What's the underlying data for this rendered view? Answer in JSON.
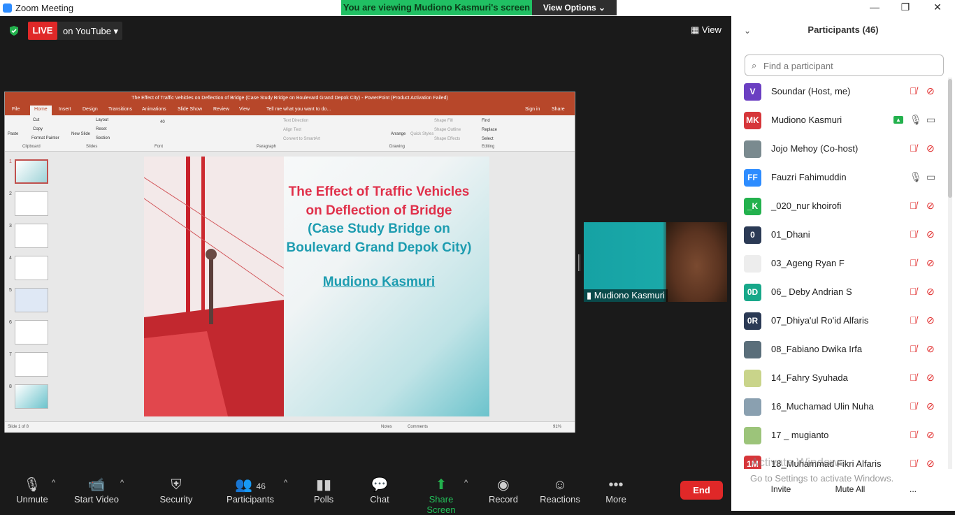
{
  "window": {
    "title": "Zoom Meeting",
    "minimize": "—",
    "restore": "❐",
    "close": "✕"
  },
  "banner": {
    "text": "You are viewing Mudiono Kasmuri's screen",
    "view_options": "View Options ⌄"
  },
  "live": {
    "badge": "LIVE",
    "destination": "on YouTube ▾"
  },
  "view_button": "▦ View",
  "ppt": {
    "title": "The Effect of Traffic Vehicles on Deflection of Bridge (Case Study Bridge on Boulevard Grand Depok City) - PowerPoint (Product Activation Failed)",
    "tabs": [
      "File",
      "Home",
      "Insert",
      "Design",
      "Transitions",
      "Animations",
      "Slide Show",
      "Review",
      "View",
      "Tell me what you want to do..."
    ],
    "sign_in": "Sign in",
    "share": "Share",
    "groups": [
      "Clipboard",
      "Slides",
      "Font",
      "Paragraph",
      "Drawing",
      "Editing"
    ],
    "ribbon_items": {
      "cut": "Cut",
      "copy": "Copy",
      "format_painter": "Format Painter",
      "paste": "Paste",
      "layout": "Layout",
      "reset": "Reset",
      "section": "Section",
      "new_slide": "New Slide",
      "font_size": "40",
      "text_direction": "Text Direction",
      "align_text": "Align Text",
      "convert": "Convert to SmartArt",
      "arrange": "Arrange",
      "quick_styles": "Quick Styles",
      "shape_fill": "Shape Fill",
      "shape_outline": "Shape Outline",
      "shape_effects": "Shape Effects",
      "find": "Find",
      "replace": "Replace",
      "select": "Select"
    },
    "slide_numbers": [
      "1",
      "2",
      "3",
      "4",
      "5",
      "6",
      "7",
      "8"
    ],
    "slide": {
      "title_red": [
        "The Effect of Traffic Vehicles",
        "on Deflection of Bridge"
      ],
      "title_teal": [
        "(Case Study Bridge on",
        "Boulevard Grand Depok City)"
      ],
      "author": "Mudiono Kasmuri"
    },
    "status": {
      "slide": "Slide 1 of 8",
      "notes": "Notes",
      "comments": "Comments",
      "zoom": "91%"
    }
  },
  "thumbnail_video": {
    "name": "Mudiono Kasmuri"
  },
  "toolbar": {
    "unmute": "Unmute",
    "start_video": "Start Video",
    "security": "Security",
    "participants": "Participants",
    "participants_count": "46",
    "polls": "Polls",
    "chat": "Chat",
    "share_screen": "Share Screen",
    "record": "Record",
    "reactions": "Reactions",
    "more": "More",
    "end": "End"
  },
  "panel": {
    "title": "Participants (46)",
    "search_placeholder": "Find a participant",
    "participants": [
      {
        "initials": "V",
        "color": "#6b3fc2",
        "name": "Soundar (Host, me)",
        "mic": "muted",
        "cam": "off"
      },
      {
        "initials": "MK",
        "color": "#d6363a",
        "name": "Mudiono Kasmuri",
        "mic": "on",
        "cam": "on",
        "sharing": true
      },
      {
        "initials": "",
        "color": "#7a8a8f",
        "name": "Jojo Mehoy (Co-host)",
        "mic": "muted",
        "cam": "off"
      },
      {
        "initials": "FF",
        "color": "#2d8cff",
        "name": "Fauzri Fahimuddin",
        "mic": "on",
        "cam": "on"
      },
      {
        "initials": "_K",
        "color": "#23b14d",
        "name": "_020_nur khoirofi",
        "mic": "muted",
        "cam": "off"
      },
      {
        "initials": "0",
        "color": "#2b3a55",
        "name": "01_Dhani",
        "mic": "muted",
        "cam": "off"
      },
      {
        "initials": "",
        "color": "#ededed",
        "name": "03_Ageng Ryan F",
        "mic": "muted",
        "cam": "off"
      },
      {
        "initials": "0D",
        "color": "#18a88a",
        "name": "06_ Deby Andrian S",
        "mic": "muted",
        "cam": "off"
      },
      {
        "initials": "0R",
        "color": "#2b3a55",
        "name": "07_Dhiya'ul Ro'id Alfaris",
        "mic": "muted",
        "cam": "off"
      },
      {
        "initials": "",
        "color": "#5a6e7a",
        "name": "08_Fabiano Dwika Irfa",
        "mic": "muted",
        "cam": "off"
      },
      {
        "initials": "",
        "color": "#c9d48a",
        "name": "14_Fahry Syuhada",
        "mic": "muted",
        "cam": "off"
      },
      {
        "initials": "",
        "color": "#8aa0b0",
        "name": "16_Muchamad Ulin Nuha",
        "mic": "muted",
        "cam": "off"
      },
      {
        "initials": "",
        "color": "#9cc47a",
        "name": "17 _ mugianto",
        "mic": "muted",
        "cam": "off"
      },
      {
        "initials": "1M",
        "color": "#d6363a",
        "name": "18_Muhammad Fikri Alfaris",
        "mic": "muted",
        "cam": "off"
      }
    ],
    "watermark_title": "Activate Windows",
    "watermark_sub": "Go to Settings to activate Windows.",
    "invite": "Invite",
    "mute_all": "Mute All",
    "more": "..."
  }
}
